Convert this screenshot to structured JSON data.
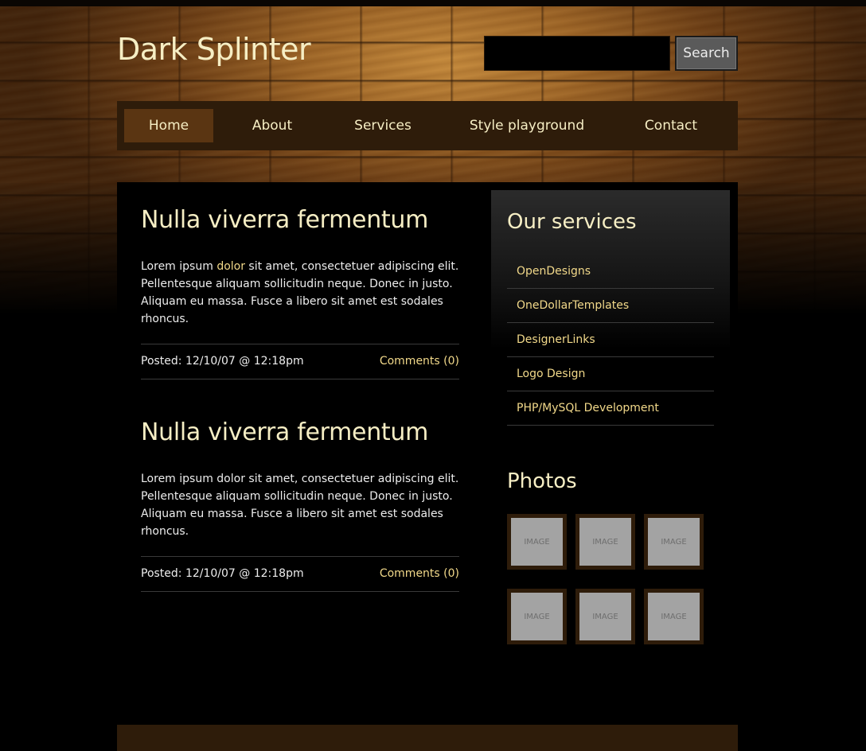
{
  "site": {
    "title": "Dark Splinter"
  },
  "search": {
    "placeholder": "",
    "button_label": "Search"
  },
  "nav": {
    "items": [
      {
        "label": "Home",
        "active": true
      },
      {
        "label": "About",
        "active": false
      },
      {
        "label": "Services",
        "active": false
      },
      {
        "label": "Style playground",
        "active": false
      },
      {
        "label": "Contact",
        "active": false
      }
    ]
  },
  "posts": [
    {
      "title": "Nulla viverra fermentum",
      "body_before": "Lorem ipsum ",
      "body_highlight": "dolor",
      "body_after": " sit amet, consectetuer adipiscing elit. Pellentesque aliquam sollicitudin neque. Donec in justo. Aliquam eu massa. Fusce a libero sit amet est sodales rhoncus.",
      "posted": "Posted: 12/10/07 @ 12:18pm",
      "comments": "Comments (0)"
    },
    {
      "title": "Nulla viverra fermentum",
      "body_before": "Lorem ipsum dolor sit amet, consectetuer adipiscing elit. Pellentesque aliquam sollicitudin neque. Donec in justo. Aliquam eu massa. Fusce a libero sit amet est sodales rhoncus.",
      "body_highlight": "",
      "body_after": "",
      "posted": "Posted: 12/10/07 @ 12:18pm",
      "comments": "Comments (0)"
    }
  ],
  "sidebar": {
    "services_title": "Our services",
    "services": [
      "OpenDesigns",
      "OneDollarTemplates",
      "DesignerLinks",
      "Logo Design",
      "PHP/MySQL Development"
    ],
    "photos_title": "Photos",
    "photos": [
      "IMAGE",
      "IMAGE",
      "IMAGE",
      "IMAGE",
      "IMAGE",
      "IMAGE"
    ]
  },
  "colors": {
    "accent": "#f2d98a",
    "title": "#f6eec4",
    "nav_bg": "#2e1c0a",
    "nav_active": "#5a3512"
  }
}
